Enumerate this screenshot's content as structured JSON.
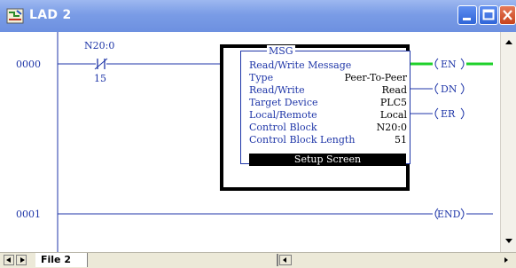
{
  "window": {
    "title": "LAD 2"
  },
  "rungs": [
    {
      "number": "0000",
      "contact": {
        "address": "N20:0",
        "bit": "15"
      },
      "msg": {
        "title": "MSG",
        "header": "Read/Write Message",
        "rows": [
          {
            "key": "Type",
            "value": "Peer-To-Peer"
          },
          {
            "key": "Read/Write",
            "value": "Read"
          },
          {
            "key": "Target Device",
            "value": "PLC5"
          },
          {
            "key": "Local/Remote",
            "value": "Local"
          },
          {
            "key": "Control Block",
            "value": "N20:0"
          },
          {
            "key": "Control Block Length",
            "value": "51"
          }
        ],
        "setup_button": "Setup Screen"
      },
      "coils": [
        "EN",
        "DN",
        "ER"
      ]
    },
    {
      "number": "0001",
      "coils": [
        "END"
      ]
    }
  ],
  "tabs": {
    "active": "File 2"
  },
  "colors": {
    "ladder_blue": "#1f36a8",
    "title_bar": "#7a9ce6",
    "en_highlight": "#1fd12b"
  }
}
